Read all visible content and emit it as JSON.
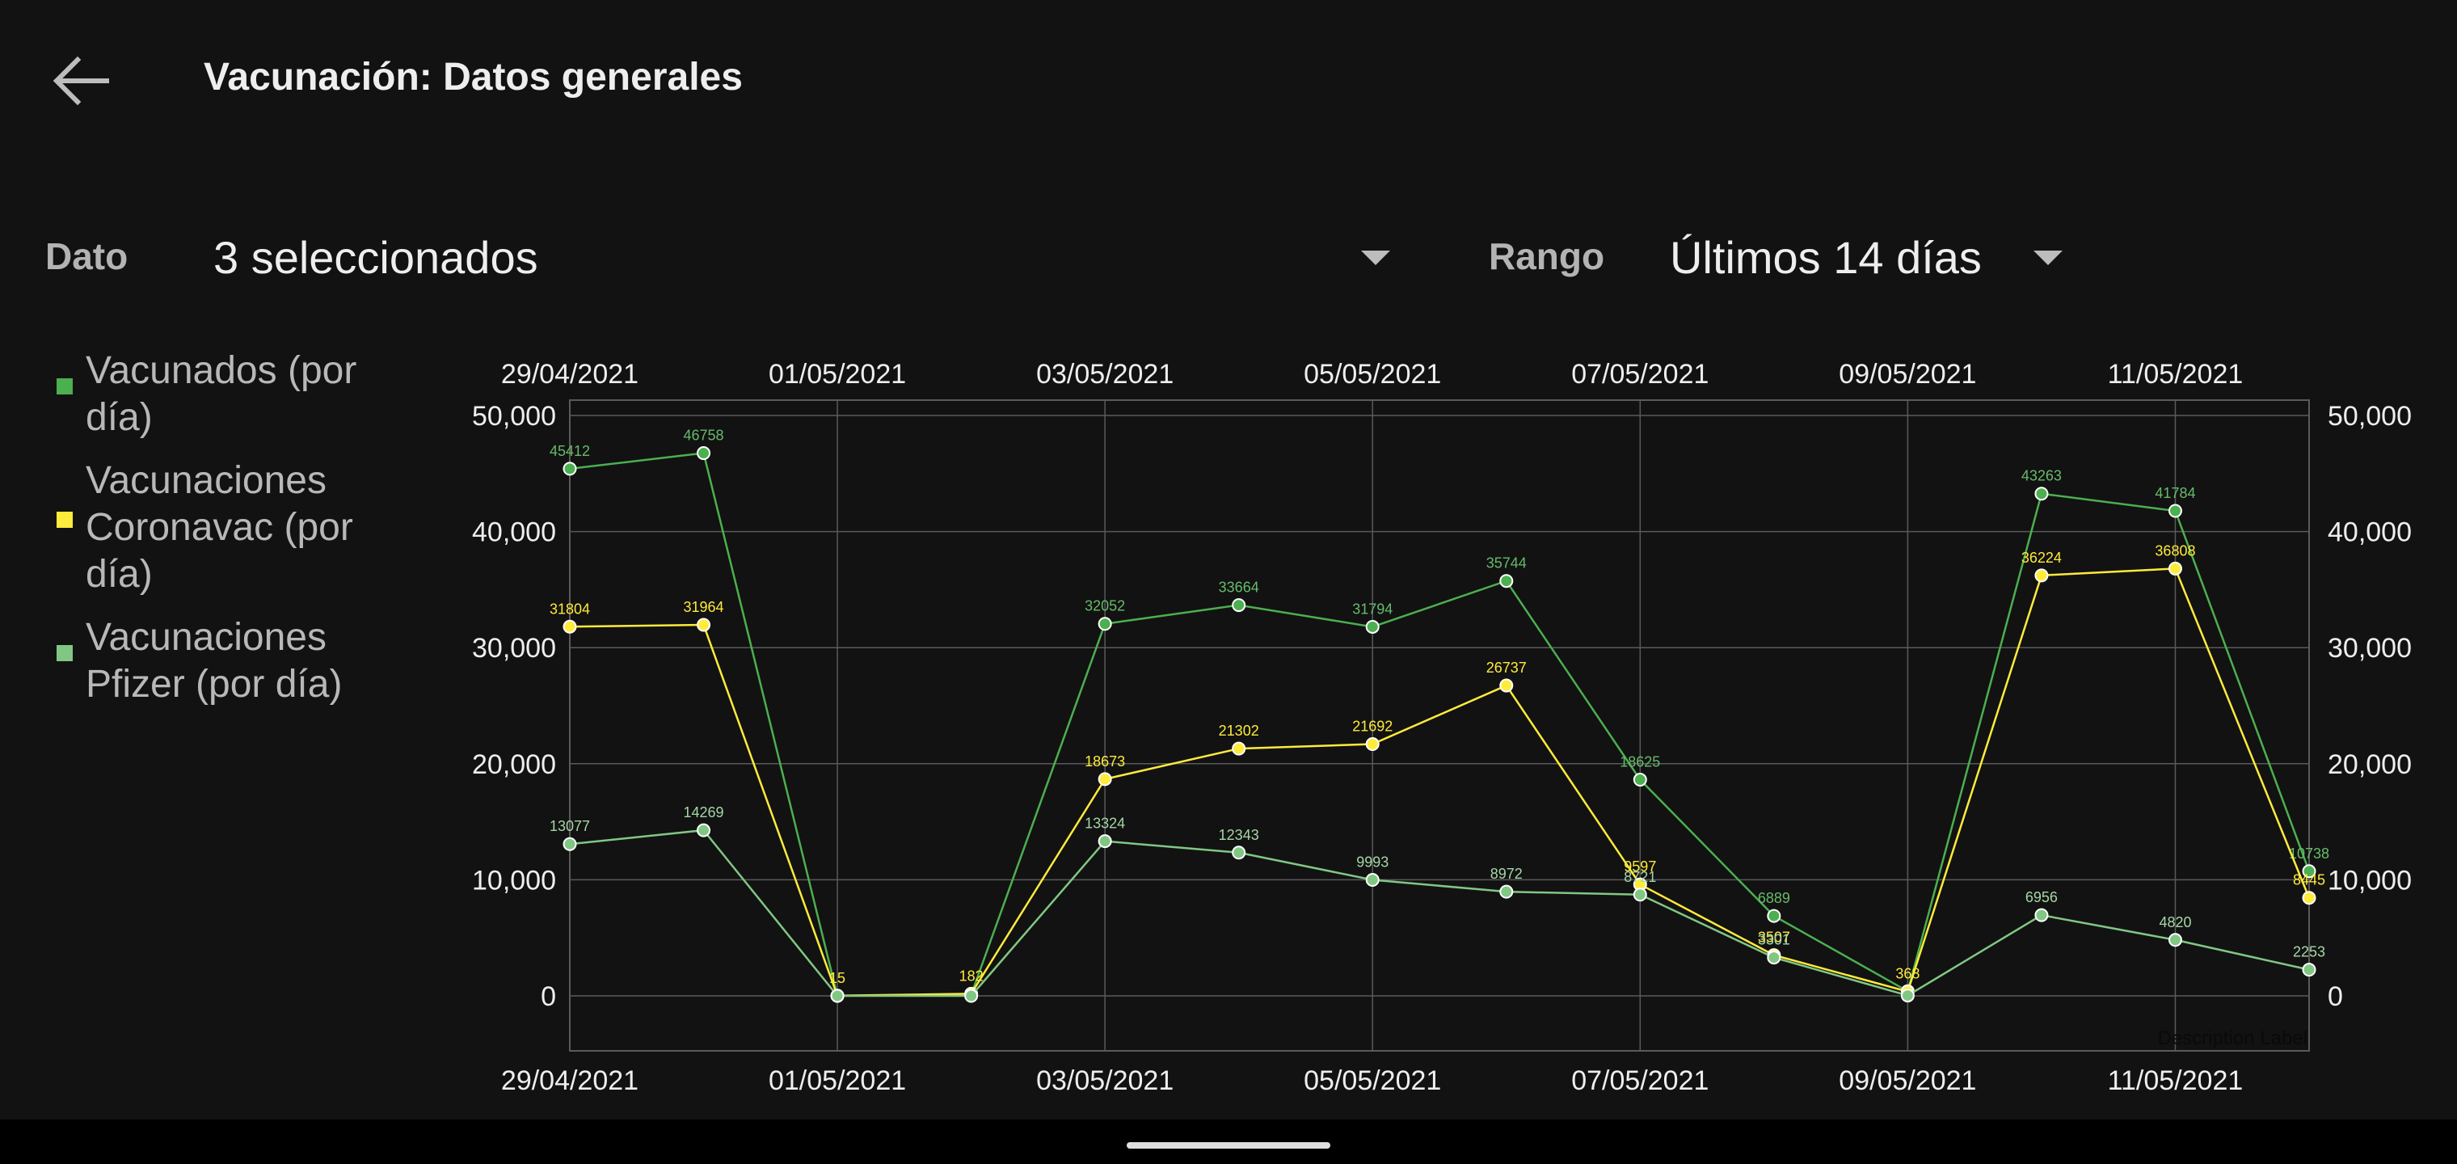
{
  "app": {
    "title": "Vacunación: Datos generales"
  },
  "filters": {
    "dato_label": "Dato",
    "dato_value": "3 seleccionados",
    "rango_label": "Rango",
    "rango_value": "Últimos 14 días"
  },
  "icons": {
    "back": "arrow-left-icon",
    "dropdown": "caret-down-icon"
  },
  "colors": {
    "background": "#121212",
    "vacunados": "#4caf50",
    "coronavac": "#ffeb3b",
    "pfizer": "#81c784",
    "grid": "#5a5a5a",
    "axis_text": "#eeeeee"
  },
  "chart_data": {
    "type": "line",
    "title": "",
    "xlabel": "",
    "ylabel": "",
    "x": [
      "29/04/2021",
      "30/04/2021",
      "01/05/2021",
      "02/05/2021",
      "03/05/2021",
      "04/05/2021",
      "05/05/2021",
      "06/05/2021",
      "07/05/2021",
      "08/05/2021",
      "09/05/2021",
      "10/05/2021",
      "11/05/2021",
      "12/05/2021"
    ],
    "x_tick_labels": [
      "29/04/2021",
      "01/05/2021",
      "03/05/2021",
      "05/05/2021",
      "07/05/2021",
      "09/05/2021",
      "11/05/2021"
    ],
    "ylim": [
      -5000,
      50000
    ],
    "y_ticks": [
      0,
      10000,
      20000,
      30000,
      40000,
      50000
    ],
    "y_tick_labels": [
      "0",
      "10,000",
      "20,000",
      "30,000",
      "40,000",
      "50,000"
    ],
    "grid": true,
    "legend_position": "left",
    "description_label": "Description Label",
    "series": [
      {
        "name": "Vacunados (por día)",
        "color": "#4caf50",
        "label_color": "#66bb6a",
        "values": [
          45412,
          46758,
          3,
          102,
          32052,
          33664,
          31794,
          35744,
          18625,
          6889,
          398,
          43263,
          41784,
          10738
        ],
        "value_labels": [
          "45412",
          "46758",
          "",
          "",
          "32052",
          "33664",
          "31794",
          "35744",
          "18625",
          "6889",
          "",
          "43263",
          "41784",
          "10738"
        ]
      },
      {
        "name": "Vacunaciones Coronavac (por día)",
        "color": "#ffeb3b",
        "label_color": "#ffeb3b",
        "values": [
          31804,
          31964,
          15,
          182,
          18673,
          21302,
          21692,
          26737,
          9597,
          3507,
          368,
          36224,
          36808,
          8445
        ],
        "value_labels": [
          "31804",
          "31964",
          "15",
          "182",
          "18673",
          "21302",
          "21692",
          "26737",
          "9597",
          "3507",
          "368",
          "36224",
          "36808",
          "8445"
        ]
      },
      {
        "name": "Vacunaciones Pfizer (por día)",
        "color": "#81c784",
        "label_color": "#a5d6a7",
        "values": [
          13077,
          14269,
          3,
          0,
          13324,
          12343,
          9993,
          8972,
          8721,
          3301,
          30,
          6956,
          4820,
          2253
        ],
        "value_labels": [
          "13077",
          "14269",
          "",
          "",
          "13324",
          "12343",
          "9993",
          "8972",
          "8721",
          "3301",
          "",
          "6956",
          "4820",
          "2253"
        ]
      }
    ]
  }
}
